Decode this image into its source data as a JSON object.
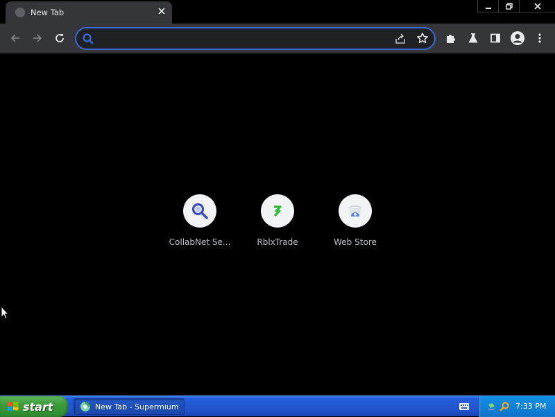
{
  "tab": {
    "title": "New Tab",
    "favicon": "globe-icon",
    "close_icon": "close-icon"
  },
  "window_controls": {
    "minimize": "minimize-icon",
    "restore": "restore-icon",
    "close": "close-icon"
  },
  "toolbar": {
    "back": "back-arrow-icon",
    "forward": "forward-arrow-icon",
    "reload": "reload-icon",
    "extensions": "puzzle-icon",
    "labs": "flask-icon",
    "side_panel": "side-panel-icon",
    "profile": "account-icon",
    "menu": "kebab-menu-icon"
  },
  "omnibox": {
    "value": "",
    "placeholder": "",
    "accent": "#3b69d6"
  },
  "shortcuts": [
    {
      "label": "CollabNet Se...",
      "icon": "search-icon",
      "color": "#3b4cc0"
    },
    {
      "label": "RblxTrade",
      "icon": "rblxtrade-icon",
      "color": "#2fbf3a"
    },
    {
      "label": "Web Store",
      "icon": "web-store-icon",
      "color": "#4a7fe0"
    }
  ],
  "taskbar": {
    "start_label": "start",
    "task_label": "New Tab - Supermium",
    "clock": "7:33 PM"
  },
  "colors": {
    "background": "#000000",
    "toolbar": "#35363a",
    "taskbar": "#245edc",
    "start": "#3c9a3c"
  }
}
